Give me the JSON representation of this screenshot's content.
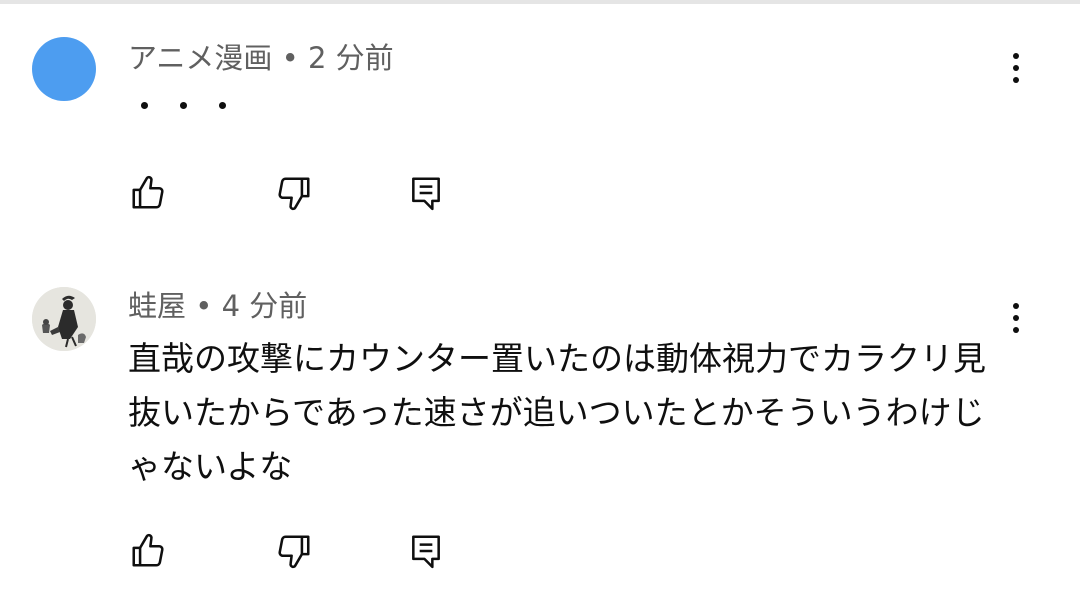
{
  "comments": [
    {
      "author": "アニメ漫画",
      "time": "2 分前",
      "text": "・・・",
      "avatar": {
        "color": "#4d9df0",
        "kind": "solid-circle"
      }
    },
    {
      "author": "蛙屋",
      "time": "4 分前",
      "text": "直哉の攻撃にカウンター置いたのは動体視力でカラクリ見抜いたからであった速さが追いついたとかそういうわけじゃないよな",
      "avatar": {
        "kind": "illustration"
      }
    }
  ],
  "separator": " • ",
  "icons": {
    "like": "thumbs-up-icon",
    "dislike": "thumbs-down-icon",
    "reply": "reply-icon",
    "more": "more-vertical-icon"
  },
  "colors": {
    "meta_text": "#606060",
    "body_text": "#0f0f0f",
    "divider": "#e5e5e5"
  }
}
